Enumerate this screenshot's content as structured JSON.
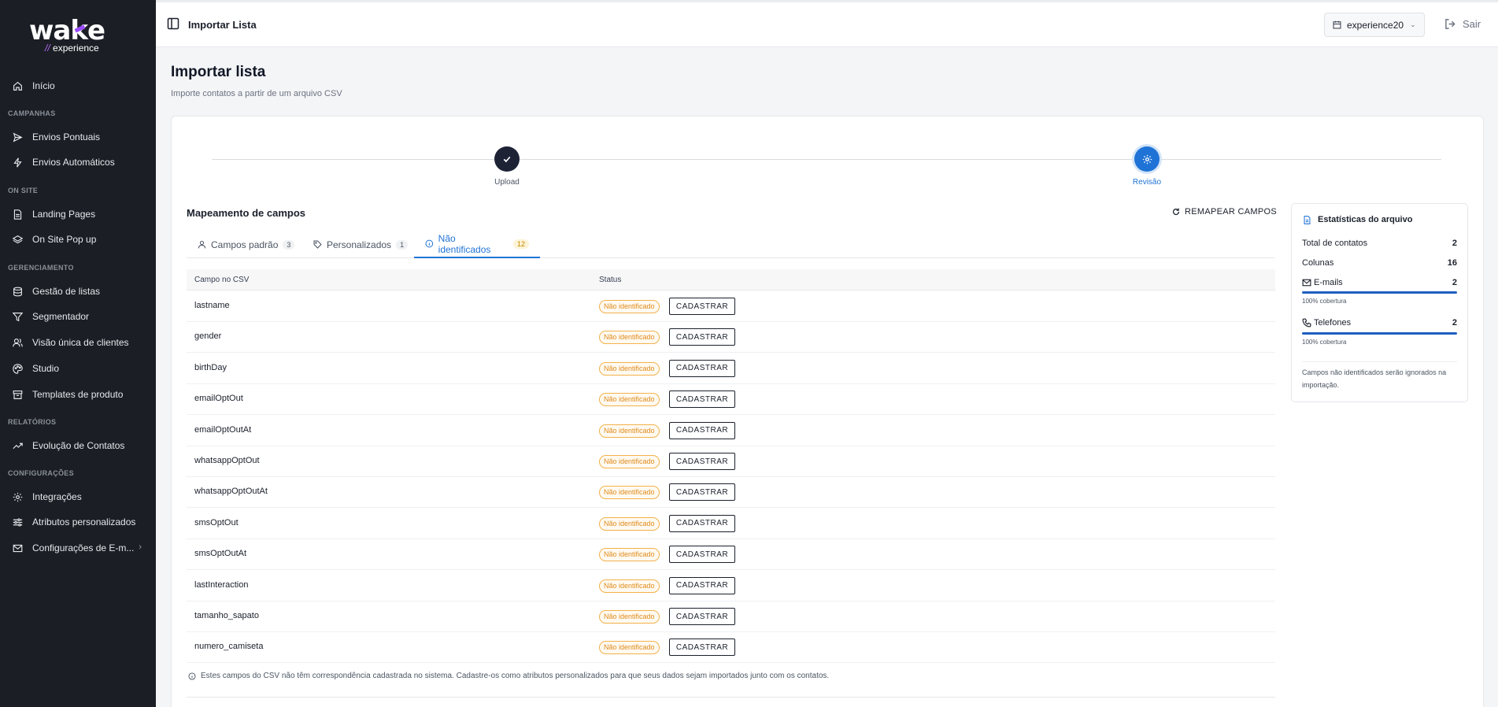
{
  "sidebar": {
    "logo": {
      "brand_a": "wa",
      "brand_k": "k",
      "brand_b": "e",
      "sub_slash": "//",
      "sub_text": "experience"
    },
    "items": [
      {
        "label": "Início",
        "icon": "home-icon"
      },
      {
        "label": "Envios Pontuais",
        "icon": "send-icon"
      },
      {
        "label": "Envios Automáticos",
        "icon": "bolt-icon"
      },
      {
        "label": "Landing Pages",
        "icon": "file-icon"
      },
      {
        "label": "On Site Pop up",
        "icon": "layers-icon"
      },
      {
        "label": "Gestão de listas",
        "icon": "database-icon"
      },
      {
        "label": "Segmentador",
        "icon": "filter-icon"
      },
      {
        "label": "Visão única de clientes",
        "icon": "users-icon"
      },
      {
        "label": "Studio",
        "icon": "palette-icon"
      },
      {
        "label": "Templates de produto",
        "icon": "archive-icon"
      },
      {
        "label": "Evolução de Contatos",
        "icon": "trend-icon"
      },
      {
        "label": "Integrações",
        "icon": "gear-icon"
      },
      {
        "label": "Atributos personalizados",
        "icon": "sliders-icon"
      },
      {
        "label": "Configurações de E-m...",
        "icon": "mail-icon"
      }
    ],
    "sections": [
      "CAMPANHAS",
      "ON SITE",
      "GERENCIAMENTO",
      "RELATÓRIOS",
      "CONFIGURAÇÕES"
    ]
  },
  "topbar": {
    "breadcrumb": "Importar Lista",
    "workspace": "experience20",
    "logout": "Sair"
  },
  "page": {
    "title": "Importar lista",
    "subtitle": "Importe contatos a partir de um arquivo CSV"
  },
  "stepper": {
    "steps": [
      {
        "label": "Upload",
        "state": "done"
      },
      {
        "label": "Revisão",
        "state": "active"
      }
    ]
  },
  "mapping": {
    "title": "Mapeamento de campos",
    "remap_label": "REMAPEAR CAMPOS",
    "tabs": [
      {
        "label": "Campos padrão",
        "count": "3"
      },
      {
        "label": "Personalizados",
        "count": "1"
      },
      {
        "label": "Não identificados",
        "count": "12"
      }
    ],
    "columns": {
      "field": "Campo no CSV",
      "status": "Status"
    },
    "status_label": "Não identificado",
    "register_label": "CADASTRAR",
    "rows": [
      "lastname",
      "gender",
      "birthDay",
      "emailOptOut",
      "emailOptOutAt",
      "whatsappOptOut",
      "whatsappOptOutAt",
      "smsOptOut",
      "smsOptOutAt",
      "lastInteraction",
      "tamanho_sapato",
      "numero_camiseta"
    ],
    "footnote": "Estes campos do CSV não têm correspondência cadastrada no sistema. Cadastre-os como atributos personalizados para que seus dados sejam importados junto com os contatos."
  },
  "stats": {
    "title": "Estatísticas do arquivo",
    "total_label": "Total de contatos",
    "total_value": "2",
    "columns_label": "Colunas",
    "columns_value": "16",
    "emails_label": "E-mails",
    "emails_value": "2",
    "emails_coverage": "100% cobertura",
    "emails_coverage_fraction": 1.0,
    "phones_label": "Telefones",
    "phones_value": "2",
    "phones_coverage": "100% cobertura",
    "phones_coverage_fraction": 1.0,
    "note": "Campos não identificados serão ignorados na importação."
  },
  "colors": {
    "accent": "#1f73d6",
    "sidebar": "#1b1e24",
    "warning": "#e08a1a",
    "brand_purple": "#9b4bff"
  }
}
